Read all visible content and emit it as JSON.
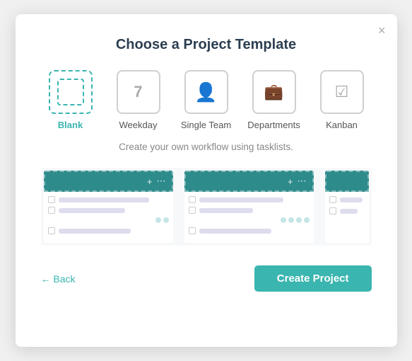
{
  "modal": {
    "title": "Choose a Project Template",
    "close_label": "×"
  },
  "templates": [
    {
      "id": "blank",
      "label": "Blank",
      "icon": "blank",
      "selected": true
    },
    {
      "id": "weekday",
      "label": "Weekday",
      "icon": "weekday",
      "selected": false
    },
    {
      "id": "single-team",
      "label": "Single Team",
      "icon": "person",
      "selected": false
    },
    {
      "id": "departments",
      "label": "Departments",
      "icon": "briefcase",
      "selected": false
    },
    {
      "id": "kanban",
      "label": "Kanban",
      "icon": "kanban",
      "selected": false
    }
  ],
  "description": "Create your own workflow using tasklists.",
  "footer": {
    "back_label": "← Back",
    "create_label": "Create Project"
  },
  "colors": {
    "accent": "#3ab5b0",
    "header_bg": "#2e8b8b"
  }
}
